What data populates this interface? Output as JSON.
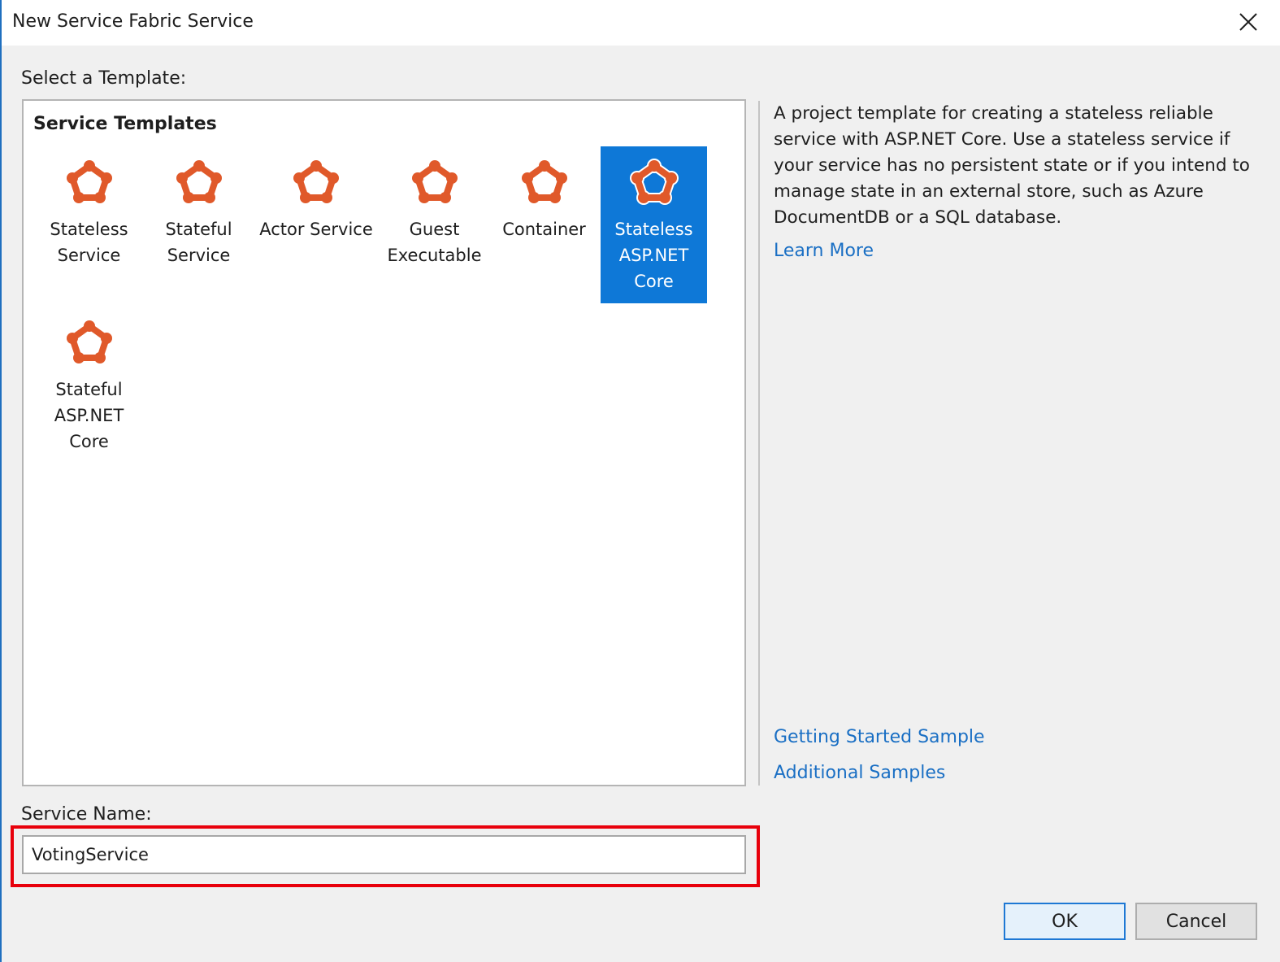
{
  "window": {
    "title": "New Service Fabric Service"
  },
  "template_picker": {
    "label": "Select a Template:",
    "heading": "Service Templates",
    "items": [
      {
        "line1": "Stateless",
        "line2": "Service",
        "line3": ""
      },
      {
        "line1": "Stateful",
        "line2": "Service",
        "line3": ""
      },
      {
        "line1": "Actor Service",
        "line2": "",
        "line3": ""
      },
      {
        "line1": "Guest",
        "line2": "Executable",
        "line3": ""
      },
      {
        "line1": "Container",
        "line2": "",
        "line3": ""
      },
      {
        "line1": "Stateless",
        "line2": "ASP.NET",
        "line3": "Core",
        "selected": true
      },
      {
        "line1": "Stateful",
        "line2": "ASP.NET",
        "line3": "Core"
      }
    ],
    "icon": "service-fabric-icon"
  },
  "description": {
    "text": "A project template for creating a stateless reliable service with ASP.NET Core. Use a stateless service if your service has no persistent state or if you intend to manage state in an external store, such as Azure DocumentDB or a SQL database.",
    "learn_more": "Learn More",
    "getting_started": "Getting Started Sample",
    "additional_samples": "Additional Samples"
  },
  "service_name": {
    "label": "Service Name:",
    "value": "VotingService"
  },
  "buttons": {
    "ok": "OK",
    "cancel": "Cancel"
  },
  "colors": {
    "accent": "#0e78d7",
    "icon": "#e0592a",
    "link": "#1a6fc4",
    "highlight": "#e8000b"
  }
}
